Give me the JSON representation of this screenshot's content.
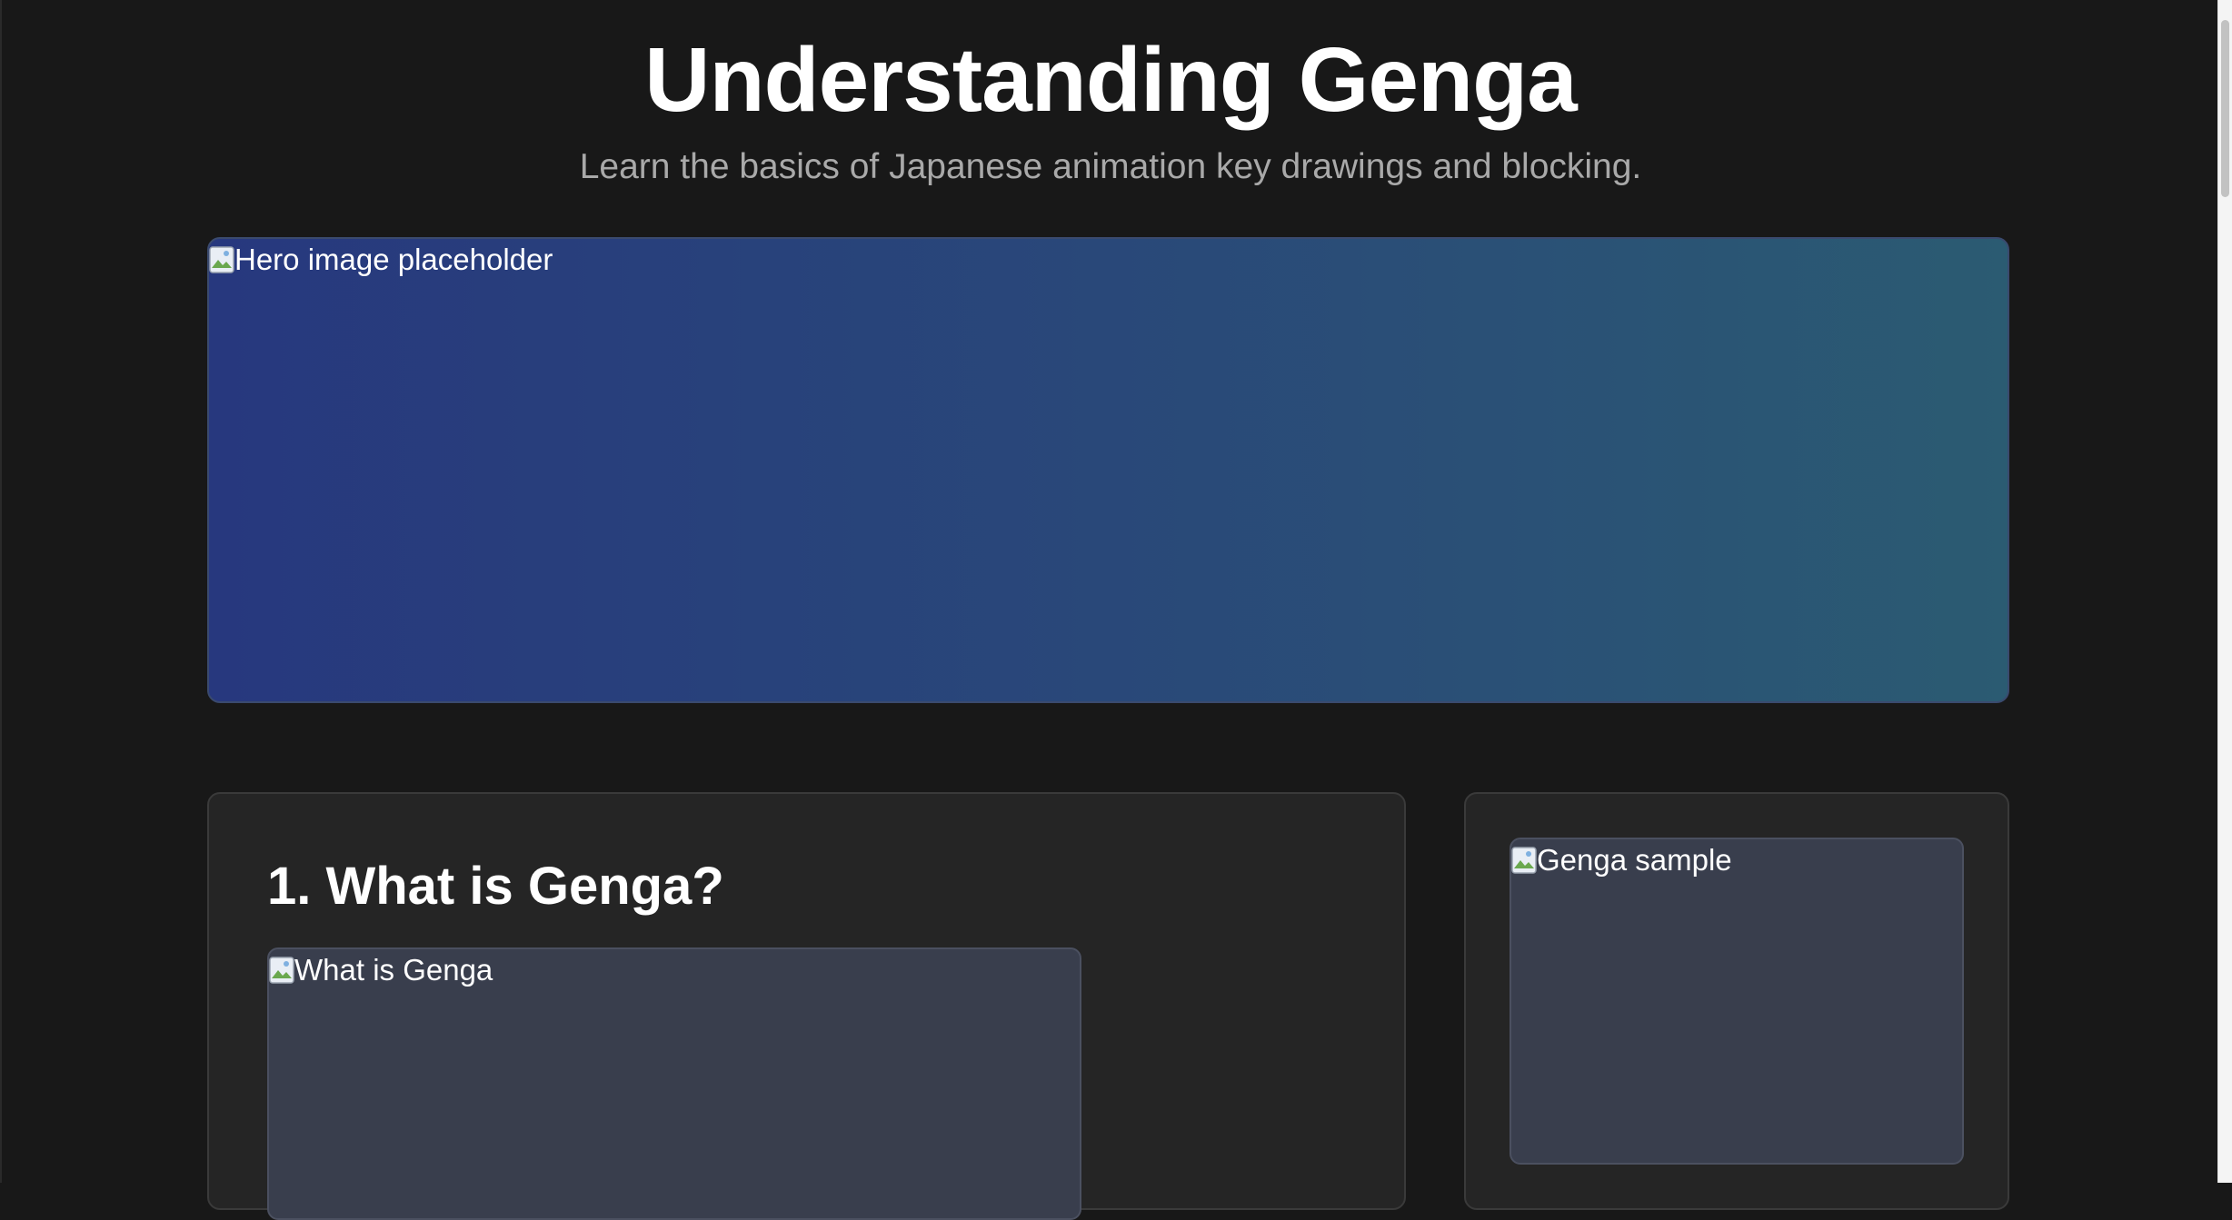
{
  "header": {
    "title": "Understanding Genga",
    "subtitle": "Learn the basics of Japanese animation key drawings and blocking."
  },
  "hero": {
    "alt": "Hero image placeholder",
    "gradient_colors": [
      "#27387e",
      "#2b5b72"
    ]
  },
  "sections": [
    {
      "heading": "1. What is Genga?",
      "image_alt": "What is Genga"
    }
  ],
  "sidebar": {
    "image_alt": "Genga sample"
  },
  "icons": {
    "broken_image": "broken-image-icon"
  },
  "colors": {
    "background": "#181818",
    "card": "#252525",
    "image_placeholder": "#393e4d",
    "subtitle": "#a9a9a9"
  }
}
